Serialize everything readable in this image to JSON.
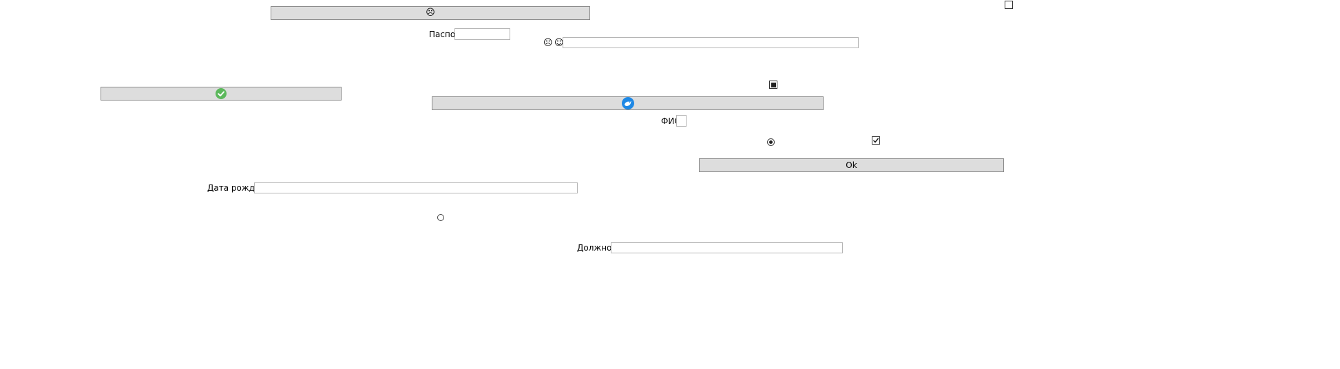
{
  "form": {
    "passport_label": "Паспорт",
    "passport_value": "",
    "fio_label": "ФИО",
    "fio_value": "",
    "birthdate_label": "Дата рождения",
    "birthdate_value": "",
    "position_label": "Должность",
    "position_value": "",
    "unlabeled_field_value": "",
    "ok_button_label": "Ok"
  },
  "icons": {
    "top_button_icon": "sad-face-icon",
    "mid_left_emoji_1": "sad-face-icon",
    "mid_left_emoji_2": "smile-face-icon",
    "green_button_icon": "check-circle-icon",
    "blue_button_icon": "bird-icon"
  },
  "states": {
    "top_right_checkbox_checked": false,
    "square_checkbox_indeterminate": true,
    "radio_top_selected": true,
    "checkmark_checkbox_checked": true,
    "radio_bottom_selected": false
  },
  "colors": {
    "button_bg": "#dddddd",
    "button_border": "#8a8a8a",
    "check_green": "#5cb85c",
    "bird_blue": "#1e88e5"
  }
}
